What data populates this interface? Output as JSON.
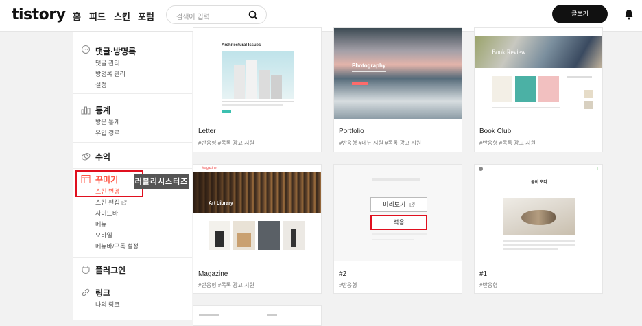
{
  "header": {
    "logo": "tistory",
    "nav": [
      "홈",
      "피드",
      "스킨",
      "포럼"
    ],
    "search_placeholder": "검색어 입력",
    "write_label": "글쓰기"
  },
  "sidebar": {
    "sections": [
      {
        "title": "댓글·방명록",
        "icon": "chat-icon",
        "items": [
          "댓글 관리",
          "방명록 관리",
          "설정"
        ]
      },
      {
        "title": "통계",
        "icon": "bar-chart-icon",
        "items": [
          "방문 통계",
          "유입 경로"
        ]
      },
      {
        "title": "수익",
        "icon": "coins-icon",
        "items": []
      },
      {
        "title": "꾸미기",
        "icon": "layout-icon",
        "items": [
          "스킨 변경",
          "스킨 편집",
          "사이드바",
          "메뉴",
          "모바일",
          "메뉴바/구독 설정"
        ]
      },
      {
        "title": "플러그인",
        "icon": "plugin-icon",
        "items": []
      },
      {
        "title": "링크",
        "icon": "link-icon",
        "items": [
          "나의 링크"
        ]
      }
    ],
    "active_item": "스킨 변경",
    "tooltip": "러블리시스터즈"
  },
  "skins": [
    {
      "name": "Letter",
      "tags": "#반응형   #목록 광고 지원",
      "thumb_title": "Architectural Issues"
    },
    {
      "name": "Portfolio",
      "tags": "#반응형   #메뉴 지원   #목록 광고 지원",
      "thumb_title": "Photography"
    },
    {
      "name": "Book Club",
      "tags": "#반응형   #목록 광고 지원",
      "thumb_title": "Book Review"
    },
    {
      "name": "Magazine",
      "tags": "#반응형   #목록 광고 지원",
      "thumb_title": "Art Library",
      "thumb_brand": "Magazine"
    },
    {
      "name": "#2",
      "tags": "#반응형",
      "preview_label": "미리보기",
      "apply_label": "적용"
    },
    {
      "name": "#1",
      "tags": "#반응형",
      "thumb_title": "봄이 오다"
    }
  ],
  "colors": {
    "accent": "#ff5544",
    "highlight": "#e0101f"
  }
}
